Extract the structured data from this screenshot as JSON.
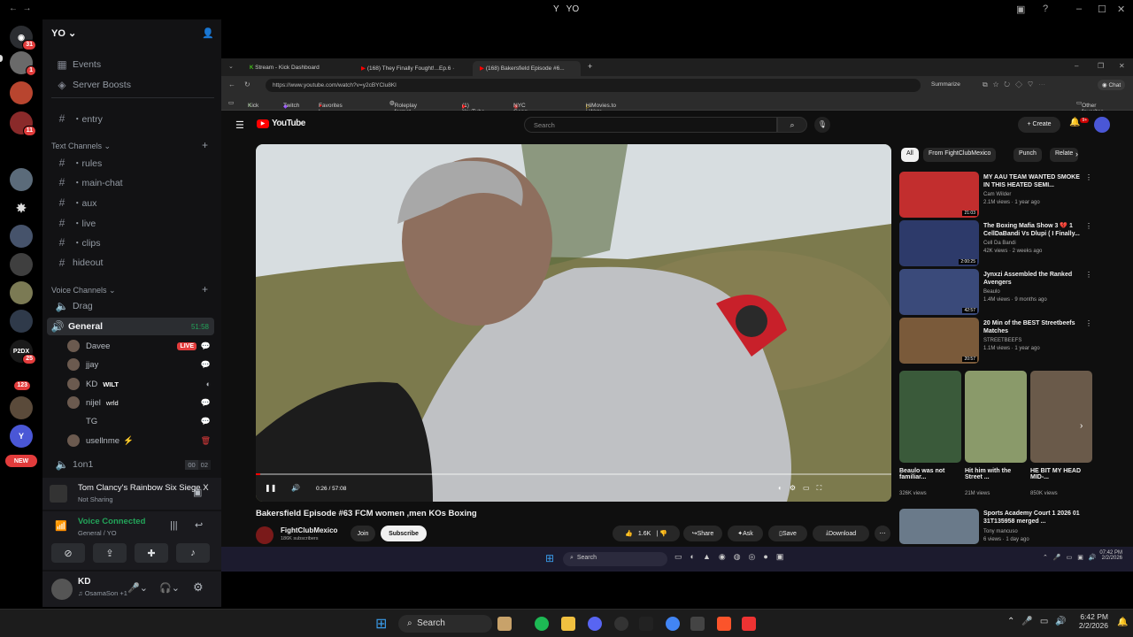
{
  "window": {
    "title": "YO",
    "logo": "Y"
  },
  "server": {
    "name": "YO"
  },
  "server_rail": {
    "badges": [
      "31",
      "1",
      "11",
      "25",
      "123",
      "NEW"
    ]
  },
  "sidebar": {
    "events": "Events",
    "boosts": "Server Boosts",
    "entry": "・entry",
    "text_category": "Text Channels",
    "text_channels": [
      "・rules",
      "・main-chat",
      "・aux",
      "・live",
      "・clips",
      "hideout"
    ],
    "voice_category": "Voice Channels",
    "voice_channels": [
      "Drag",
      "General",
      "1on1"
    ],
    "general_timer": "51:58",
    "onon_counts": [
      "00",
      "02"
    ],
    "voice_users": [
      {
        "name": "Davee",
        "tag": ""
      },
      {
        "name": "jjay",
        "tag": ""
      },
      {
        "name": "KD",
        "tag": "WILT"
      },
      {
        "name": "nijel",
        "tag": "wrld"
      },
      {
        "name": "TG",
        "tag": ""
      },
      {
        "name": "usellnme",
        "tag": ""
      }
    ],
    "live_label": "LIVE"
  },
  "activity": {
    "game": "Tom Clancy's Rainbow Six Siege X",
    "status": "Not Sharing"
  },
  "voice": {
    "status": "Voice Connected",
    "location": "General / YO"
  },
  "user": {
    "name": "KD",
    "sub": "OsamaSon +1"
  },
  "browser": {
    "tabs": [
      "Stream - Kick Dashboard",
      "(168) They Finally Fought!...Ep.6 ·",
      "(168) Bakersfield Episode #6..."
    ],
    "url": "https://www.youtube.com/watch?v=y2cBYClu8Kl",
    "summarize": "Summarize",
    "chat": "Chat",
    "bookmarks": [
      "Kick",
      "Twitch",
      "Favorites | Myinsta...",
      "Roleplay format gu...",
      "(1) YouTube",
      "NYC Gang Map 3.0...",
      "HiMovies.to | Watc..."
    ],
    "other_favorites": "Other favorites"
  },
  "youtube": {
    "logo": "YouTube",
    "search_placeholder": "Search",
    "create": "Create",
    "notif_count": "9+",
    "video_title": "Bakersfield Episode #63 FCM women ,men KOs Boxing",
    "channel": "FightClubMexico",
    "subscribers": "186K subscribers",
    "join": "Join",
    "subscribe": "Subscribe",
    "likes": "1.6K",
    "share": "Share",
    "ask": "Ask",
    "save": "Save",
    "download": "Download",
    "time": "0:26 / 57:08",
    "chips": [
      "All",
      "From FightClubMexico",
      "Punch",
      "Relate"
    ],
    "recs": [
      {
        "title": "MY AAU TEAM WANTED SMOKE IN THIS HEATED SEMI...",
        "channel": "Cam Wilder",
        "meta": "2.1M views · 1 year ago",
        "dur": "21:03"
      },
      {
        "title": "The Boxing Mafia Show 3 💔 1 CellDaBandi Vs Dlupi ( I Finally...",
        "channel": "Cell Da Bandi",
        "meta": "42K views · 2 weeks ago",
        "dur": "2:00:25"
      },
      {
        "title": "Jynxzi Assembled the Ranked Avengers",
        "channel": "Beaulo",
        "meta": "1.4M views · 9 months ago",
        "dur": "42:57"
      },
      {
        "title": "20 Min of the BEST Streetbeefs Matches",
        "channel": "STREETBEEFS",
        "meta": "1.1M views · 1 year ago",
        "dur": "20:57"
      }
    ],
    "shorts": [
      {
        "title": "Beaulo was not familiar...",
        "meta": "326K views"
      },
      {
        "title": "Hit him with the Street ...",
        "meta": "21M views"
      },
      {
        "title": "HE BIT MY HEAD MID-...",
        "meta": "850K views"
      }
    ],
    "bottom_rec": {
      "title": "Sports Academy Court 1 2026 01 31T135958 merged ...",
      "channel": "Tony mancuso",
      "meta": "6 views · 1 day ago"
    }
  },
  "inner_taskbar": {
    "search": "Search",
    "time": "07:42 PM",
    "date": "2/2/2026"
  },
  "taskbar": {
    "search": "Search",
    "time": "6:42 PM",
    "date": "2/2/2026"
  }
}
